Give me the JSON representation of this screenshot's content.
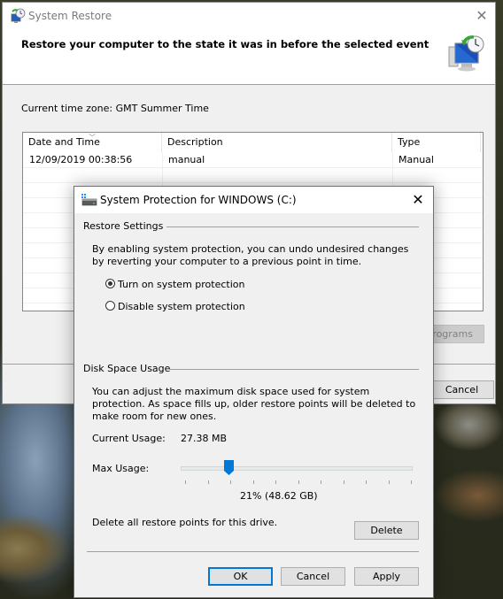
{
  "main_window": {
    "title": "System Restore",
    "icon": "system-restore-icon",
    "close_icon": "close-icon",
    "heading": "Restore your computer to the state it was in before the selected event",
    "header_icon": "system-restore-large-icon",
    "timezone_label": "Current time zone: GMT Summer Time",
    "table": {
      "columns": [
        "Date and Time",
        "Description",
        "Type"
      ],
      "sort_indicator": "chevron-down-icon",
      "rows": [
        {
          "date_time": "12/09/2019 00:38:56",
          "description": "manual",
          "type": "Manual"
        }
      ]
    },
    "scan_programs_button": "Scan for affected programs",
    "scan_programs_visible_text": "programs",
    "cancel_button": "Cancel"
  },
  "dialog": {
    "title": "System Protection for WINDOWS (C:)",
    "icon": "drive-icon",
    "close_icon": "close-icon",
    "restore_settings": {
      "group_label": "Restore Settings",
      "description": "By enabling system protection, you can undo undesired changes by reverting your computer to a previous point in time.",
      "options": [
        {
          "label": "Turn on system protection",
          "selected": true
        },
        {
          "label": "Disable system protection",
          "selected": false
        }
      ]
    },
    "disk_space": {
      "group_label": "Disk Space Usage",
      "description": "You can adjust the maximum disk space used for system protection. As space fills up, older restore points will be deleted to make room for new ones.",
      "current_usage_label": "Current Usage:",
      "current_usage_value": "27.38 MB",
      "max_usage_label": "Max Usage:",
      "max_usage_percent": 21,
      "max_usage_text": "21% (48.62 GB)",
      "tick_count": 11
    },
    "delete_text": "Delete all restore points for this drive.",
    "delete_button": "Delete",
    "ok_button": "OK",
    "cancel_button": "Cancel",
    "apply_button": "Apply",
    "accent_color": "#0078d7"
  }
}
